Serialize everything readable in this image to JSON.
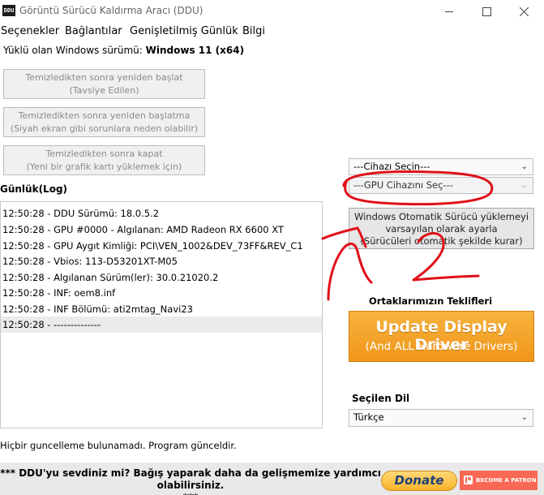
{
  "window": {
    "title": "Görüntü Sürücü Kaldırma Aracı (DDU)",
    "icon_text": "DDU"
  },
  "menu": {
    "items": [
      "Seçenekler",
      "Bağlantılar",
      "Genişletilmiş Günlük",
      "Bilgi"
    ]
  },
  "os": {
    "label": "Yüklü olan Windows sürümü:",
    "value": "Windows 11 (x64)"
  },
  "actions": {
    "clean_restart_line1": "Temizledikten sonra yeniden başlat",
    "clean_restart_line2": "(Tavsiye Edilen)",
    "clean_norestart_line1": "Temizledikten sonra yeniden başlatma",
    "clean_norestart_line2": "(Siyah ekran gibi sorunlara neden olabilir)",
    "clean_shutdown_line1": "Temizledikten sonra kapat",
    "clean_shutdown_line2": "(Yeni bir grafik kartı yüklemek için)"
  },
  "log": {
    "label": "Günlük(Log)",
    "entries": [
      "12:50:28 - DDU Sürümü: 18.0.5.2",
      "12:50:28 - GPU #0000 - Algılanan: AMD Radeon RX 6600 XT",
      "12:50:28 - GPU Aygıt Kimliği: PCI\\VEN_1002&DEV_73FF&REV_C1",
      "12:50:28 - Vbios: 113-D53201XT-M05",
      "12:50:28 - Algılanan Sürüm(ler): 30.0.21020.2",
      "12:50:28 - INF: oem8.inf",
      "12:50:28 - INF Bölümü: ati2mtag_Navi23",
      "12:50:28 - --------------"
    ]
  },
  "device_select": {
    "value": "---Cihazı Seçin---"
  },
  "gpu_select": {
    "value": "---GPU Cihazını Seç---"
  },
  "auto_update_button": {
    "line1": "Windows Otomatik Sürücü yüklemeyi",
    "line2": "varsayılan olarak ayarla",
    "line3": "(Sürücüleri otomatik şekilde kurar)"
  },
  "offers": {
    "label": "Ortaklarımızın Teklifleri",
    "ad_line1": "Update Display Driver",
    "ad_line2": "(And ALL Hardware Drivers)",
    "ad_color": "#f0961a"
  },
  "language": {
    "label": "Seçilen Dil",
    "value": "Türkçe"
  },
  "status": {
    "text": "Hiçbir guncelleme bulunamadı. Program günceldir."
  },
  "footer": {
    "line1": "*** DDU'yu sevdiniz mi? Bağış yaparak daha da gelişmemize yardımcı olabilirsiniz.",
    "line2": "***",
    "donate_label": "Donate",
    "patron_label": "BECOME A PATRON"
  },
  "annotation": {
    "number": "2",
    "color": "#e0101a"
  }
}
